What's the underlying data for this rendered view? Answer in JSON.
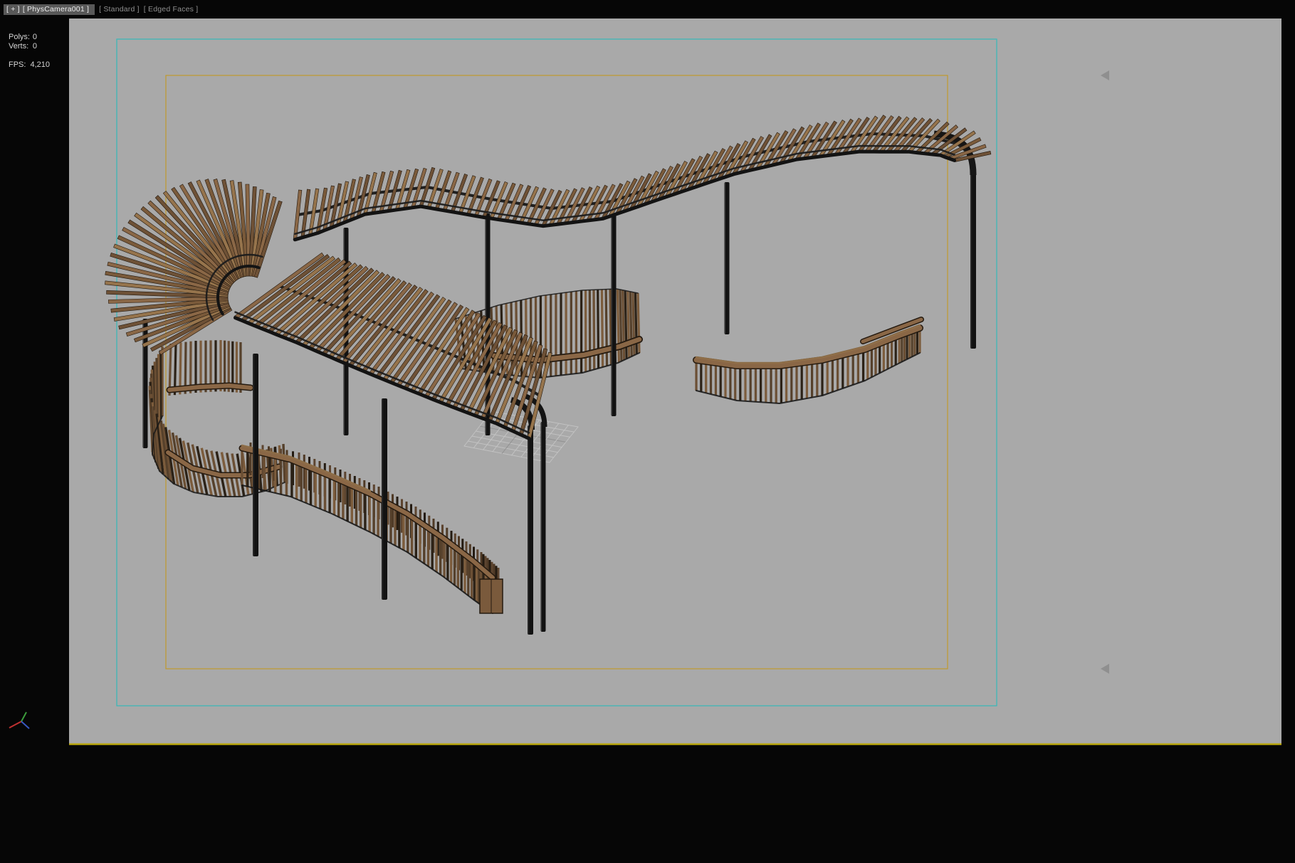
{
  "viewport_label": {
    "expand": "[ + ]",
    "point_of_view": "[ PhysCamera001 ]",
    "shading_quality": "[ Standard ]",
    "shading_style": "[ Edged Faces ]"
  },
  "statistics": {
    "polys_label": "Polys:",
    "polys_value": "0",
    "verts_label": "Verts:",
    "verts_value": "0",
    "fps_label": "FPS:",
    "fps_value": "4,210"
  },
  "colors": {
    "background": "#060606",
    "viewport_bg": "#a9a9a9",
    "safe_frame_outer": "#35b8b8",
    "safe_frame_action": "#c0992c",
    "active_border": "#b9a70e",
    "wood_light": "#96744c",
    "wood_mid": "#8a6746",
    "wood_dark": "#6e5136",
    "frame_dark": "#151515",
    "axis_x": "#c03030",
    "axis_y": "#3c9c3c",
    "axis_z": "#3858c0"
  }
}
